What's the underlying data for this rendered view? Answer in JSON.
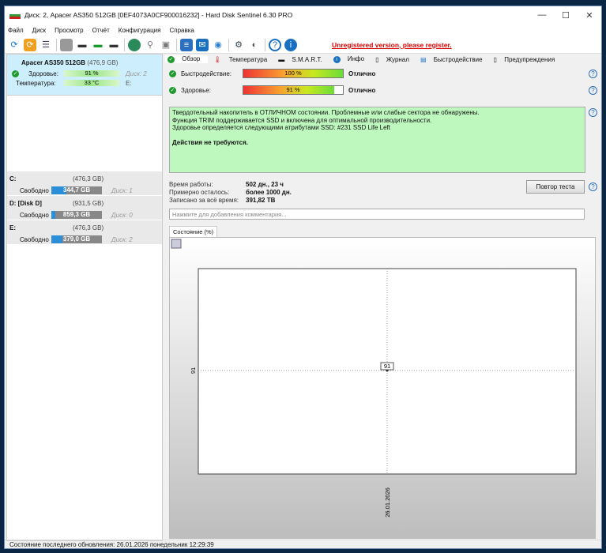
{
  "window": {
    "title": "Диск: 2, Apacer AS350 512GB [0EF4073A0CF900016232]  -  Hard Disk Sentinel 6.30 PRO",
    "minimize": "—",
    "maximize": "☐",
    "close": "✕"
  },
  "menu": [
    "Файл",
    "Диск",
    "Просмотр",
    "Отчёт",
    "Конфигурация",
    "Справка"
  ],
  "toolbar": {
    "unregistered": "Unregistered version, please register."
  },
  "disk": {
    "name": "Apacer AS350 512GB",
    "size": "(476,9 GB)",
    "health_label": "Здоровье:",
    "health": "91 %",
    "disk_no": "Диск: 2",
    "temp_label": "Температура:",
    "temp": "33 °C",
    "letter": "E:"
  },
  "partitions": [
    {
      "name": "C:",
      "size": "(476,3 GB)",
      "free_label": "Свободно",
      "free": "344,7 GB",
      "free_fraction": 0.3,
      "disk": "Диск: 1"
    },
    {
      "name": "D: [Disk D]",
      "size": "(931,5 GB)",
      "free_label": "Свободно",
      "free": "859,3 GB",
      "free_fraction": 0.08,
      "disk": "Диск: 0"
    },
    {
      "name": "E:",
      "size": "(476,3 GB)",
      "free_label": "Свободно",
      "free": "379,0 GB",
      "free_fraction": 0.22,
      "disk": "Диск: 2"
    }
  ],
  "tabs": [
    "Обзор",
    "Температура",
    "S.M.A.R.T.",
    "Инфо",
    "Журнал",
    "Быстродействие",
    "Предупреждения"
  ],
  "performance": {
    "label": "Быстродействие:",
    "value": "100 %",
    "percent": 100,
    "rating": "Отлично"
  },
  "health": {
    "label": "Здоровье:",
    "value": "91 %",
    "percent": 91,
    "rating": "Отлично"
  },
  "message": {
    "lines": [
      "Твердотельный накопитель в ОТЛИЧНОМ состоянии. Проблемные или слабые сектора не обнаружены.",
      "Функция TRIM поддерживается SSD и включена для оптимальной производительности.",
      "Здоровье определяется следующими атрибутами SSD: #231 SSD Life Left"
    ],
    "action": "Действия не требуются."
  },
  "stats": [
    {
      "k": "Время работы:",
      "v": "502 дн., 23 ч"
    },
    {
      "k": "Примерно осталось:",
      "v": "более 1000 дн."
    },
    {
      "k": "Записано за всё время:",
      "v": "391,82 TB"
    }
  ],
  "retest": "Повтор теста",
  "comment_placeholder": "Нажмите для добавления комментария...",
  "chart_tab": "Состояние (%)",
  "chart_data": {
    "type": "line",
    "x": [
      "26.01.2026"
    ],
    "values": [
      91
    ],
    "ytick": "91",
    "xtick": "26.01.2026",
    "data_label": "91",
    "grid": true
  },
  "status": "Состояние последнего обновления: 26.01.2026 понедельник 12:29:39"
}
